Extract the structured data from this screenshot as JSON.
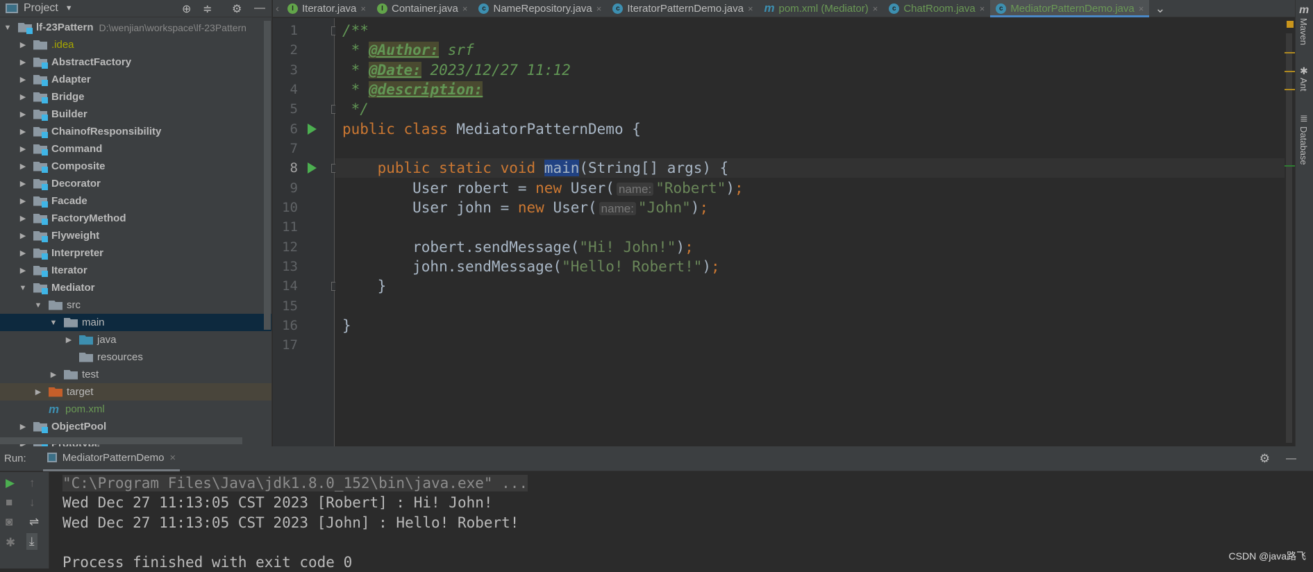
{
  "project_panel": {
    "title": "Project",
    "tree": [
      {
        "label": "lf-23Pattern",
        "path": "D:\\wenjian\\workspace\\lf-23Pattern",
        "depth": 0,
        "arrow": "down",
        "icon": "module",
        "bold": true
      },
      {
        "label": ".idea",
        "depth": 1,
        "arrow": "right",
        "icon": "folder",
        "color": "#a8a800"
      },
      {
        "label": "AbstractFactory",
        "depth": 1,
        "arrow": "right",
        "icon": "module",
        "bold": true
      },
      {
        "label": "Adapter",
        "depth": 1,
        "arrow": "right",
        "icon": "module",
        "bold": true
      },
      {
        "label": "Bridge",
        "depth": 1,
        "arrow": "right",
        "icon": "module",
        "bold": true
      },
      {
        "label": "Builder",
        "depth": 1,
        "arrow": "right",
        "icon": "module",
        "bold": true
      },
      {
        "label": "ChainofResponsibility",
        "depth": 1,
        "arrow": "right",
        "icon": "module",
        "bold": true
      },
      {
        "label": "Command",
        "depth": 1,
        "arrow": "right",
        "icon": "module",
        "bold": true
      },
      {
        "label": "Composite",
        "depth": 1,
        "arrow": "right",
        "icon": "module",
        "bold": true
      },
      {
        "label": "Decorator",
        "depth": 1,
        "arrow": "right",
        "icon": "module",
        "bold": true
      },
      {
        "label": "Facade",
        "depth": 1,
        "arrow": "right",
        "icon": "module",
        "bold": true
      },
      {
        "label": "FactoryMethod",
        "depth": 1,
        "arrow": "right",
        "icon": "module",
        "bold": true
      },
      {
        "label": "Flyweight",
        "depth": 1,
        "arrow": "right",
        "icon": "module",
        "bold": true
      },
      {
        "label": "Interpreter",
        "depth": 1,
        "arrow": "right",
        "icon": "module",
        "bold": true
      },
      {
        "label": "Iterator",
        "depth": 1,
        "arrow": "right",
        "icon": "module",
        "bold": true
      },
      {
        "label": "Mediator",
        "depth": 1,
        "arrow": "down",
        "icon": "module",
        "bold": true
      },
      {
        "label": "src",
        "depth": 2,
        "arrow": "down",
        "icon": "folder"
      },
      {
        "label": "main",
        "depth": 3,
        "arrow": "down",
        "icon": "folder",
        "selected": true
      },
      {
        "label": "java",
        "depth": 4,
        "arrow": "right",
        "icon": "source-folder"
      },
      {
        "label": "resources",
        "depth": 4,
        "arrow": "none",
        "icon": "resources-folder"
      },
      {
        "label": "test",
        "depth": 3,
        "arrow": "right",
        "icon": "folder"
      },
      {
        "label": "target",
        "depth": 2,
        "arrow": "right",
        "icon": "excluded-folder",
        "highlight": true
      },
      {
        "label": "pom.xml",
        "depth": 2,
        "arrow": "none",
        "icon": "maven",
        "color": "#6a9955"
      },
      {
        "label": "ObjectPool",
        "depth": 1,
        "arrow": "right",
        "icon": "module",
        "bold": true
      },
      {
        "label": "Prototype",
        "depth": 1,
        "arrow": "right",
        "icon": "module",
        "bold": true
      }
    ]
  },
  "tabs": [
    {
      "label": "Iterator.java",
      "icon": "interface"
    },
    {
      "label": "Container.java",
      "icon": "interface"
    },
    {
      "label": "NameRepository.java",
      "icon": "class"
    },
    {
      "label": "IteratorPatternDemo.java",
      "icon": "class-main"
    },
    {
      "label": "pom.xml (Mediator)",
      "icon": "maven"
    },
    {
      "label": "ChatRoom.java",
      "icon": "class"
    },
    {
      "label": "MediatorPatternDemo.java",
      "icon": "class-main",
      "active": true
    }
  ],
  "editor": {
    "current_line": 8,
    "run_lines": [
      6,
      8
    ],
    "lines": [
      [
        [
          "/**",
          "doc"
        ]
      ],
      [
        [
          " * ",
          "doc"
        ],
        [
          "@Author:",
          "tag"
        ],
        [
          " srf",
          "docv"
        ]
      ],
      [
        [
          " * ",
          "doc"
        ],
        [
          "@Date:",
          "tag"
        ],
        [
          " 2023/12/27 11:12",
          "docv"
        ]
      ],
      [
        [
          " * ",
          "doc"
        ],
        [
          "@description:",
          "tag"
        ]
      ],
      [
        [
          " */",
          "doc"
        ]
      ],
      [
        [
          "public class ",
          "kw"
        ],
        [
          "MediatorPatternDemo {",
          ""
        ]
      ],
      [],
      [
        [
          "    public static void ",
          "kw"
        ],
        [
          "main",
          "selw"
        ],
        [
          "(String[] args) {",
          ""
        ]
      ],
      [
        [
          "        User robert = ",
          ""
        ],
        [
          "new ",
          "kw"
        ],
        [
          "User(",
          ""
        ],
        [
          "name:",
          "hint"
        ],
        [
          "\"Robert\"",
          "str"
        ],
        [
          ")",
          ""
        ],
        [
          ";",
          "kw"
        ]
      ],
      [
        [
          "        User john = ",
          ""
        ],
        [
          "new ",
          "kw"
        ],
        [
          "User(",
          ""
        ],
        [
          "name:",
          "hint"
        ],
        [
          "\"John\"",
          "str"
        ],
        [
          ")",
          ""
        ],
        [
          ";",
          "kw"
        ]
      ],
      [],
      [
        [
          "        robert.sendMessage(",
          ""
        ],
        [
          "\"Hi! John!\"",
          "str"
        ],
        [
          ")",
          ""
        ],
        [
          ";",
          "kw"
        ]
      ],
      [
        [
          "        john.sendMessage(",
          ""
        ],
        [
          "\"Hello! Robert!\"",
          "str"
        ],
        [
          ")",
          ""
        ],
        [
          ";",
          "kw"
        ]
      ],
      [
        [
          "    }",
          ""
        ]
      ],
      [],
      [
        [
          "}",
          ""
        ]
      ],
      []
    ]
  },
  "right_tools": [
    "Maven",
    "Ant",
    "Database"
  ],
  "run_panel": {
    "label": "Run:",
    "tab": "MediatorPatternDemo",
    "console": [
      "\"C:\\Program Files\\Java\\jdk1.8.0_152\\bin\\java.exe\" ...",
      "Wed Dec 27 11:13:05 CST 2023 [Robert] : Hi! John!",
      "Wed Dec 27 11:13:05 CST 2023 [John] : Hello! Robert!",
      "",
      "Process finished with exit code 0"
    ]
  },
  "watermark": "CSDN @java路飞"
}
